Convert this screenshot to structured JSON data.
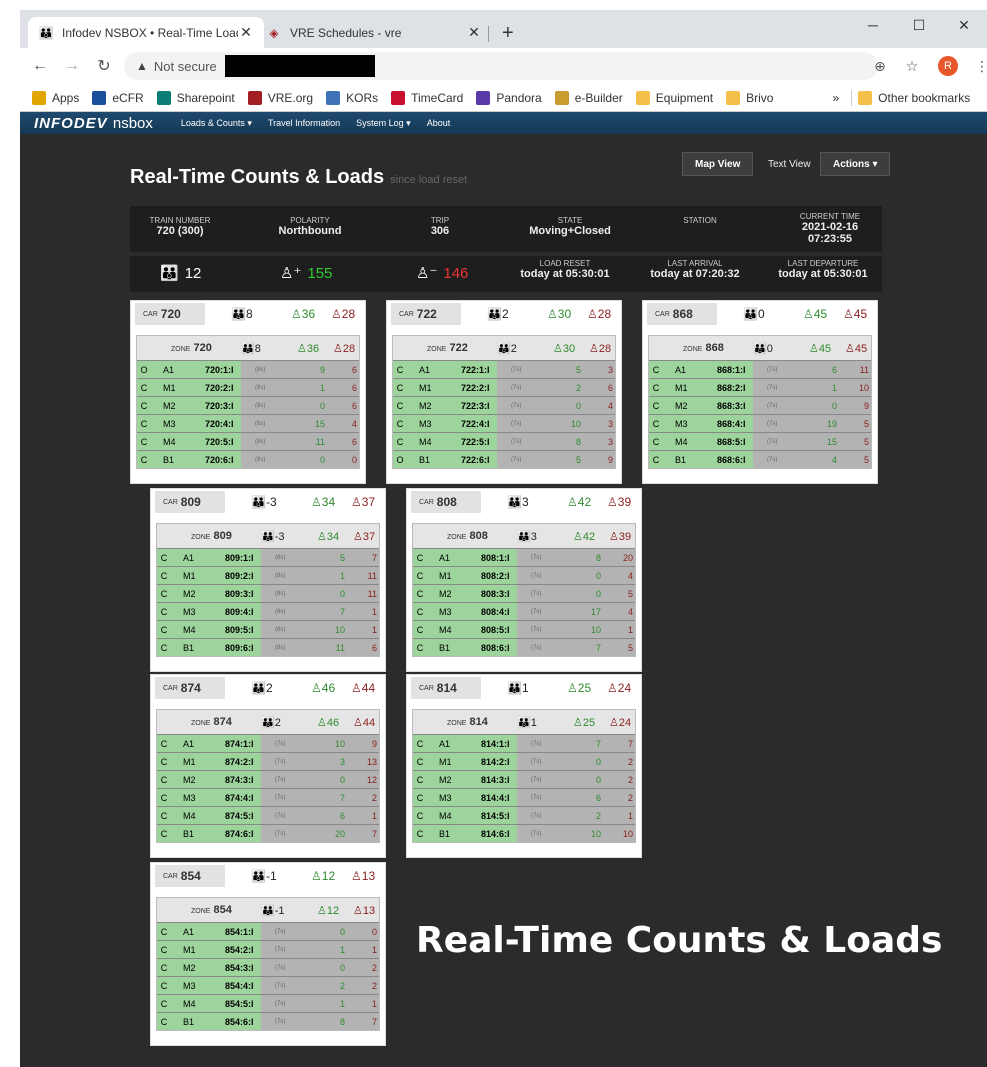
{
  "browser": {
    "tabs": [
      {
        "title": "Infodev NSBOX • Real-Time Load",
        "close": "✕",
        "active": true
      },
      {
        "title": "VRE Schedules - vre",
        "close": "✕",
        "active": false
      }
    ],
    "new_tab": "+",
    "address": {
      "warning": "Not secure"
    },
    "profile_initial": "R",
    "bookmarks": [
      {
        "label": "Apps",
        "color": "#e2a600"
      },
      {
        "label": "eCFR",
        "color": "#1a4f9e"
      },
      {
        "label": "Sharepoint",
        "color": "#0a7c74"
      },
      {
        "label": "VRE.org",
        "color": "#a31e22"
      },
      {
        "label": "KORs",
        "color": "#3f73b8"
      },
      {
        "label": "TimeCard",
        "color": "#c8102e"
      },
      {
        "label": "Pandora",
        "color": "#5a3aa8"
      },
      {
        "label": "e-Builder",
        "color": "#c89c2f"
      },
      {
        "label": "Equipment",
        "color": "#f5c04a"
      },
      {
        "label": "Brivo",
        "color": "#f5c04a"
      }
    ],
    "bookmarks_more": "»",
    "other_bookmarks": "Other bookmarks"
  },
  "app": {
    "brand": "INFODEV",
    "brand_sub": "nsbox",
    "nav": [
      "Loads & Counts ▾",
      "Travel Information",
      "System Log ▾",
      "About"
    ],
    "title": "Real-Time Counts & Loads",
    "title_suffix": "since load reset",
    "buttons": {
      "map": "Map View",
      "text": "Text View",
      "actions": "Actions ▾"
    },
    "info": {
      "train_number_label": "TRAIN NUMBER",
      "train_number": "720 (300)",
      "polarity_label": "POLARITY",
      "polarity": "Northbound",
      "trip_label": "TRIP",
      "trip": "306",
      "state_label": "STATE",
      "state": "Moving+Closed",
      "station_label": "STATION",
      "current_time_label": "CURRENT TIME",
      "current_date": "2021-02-16",
      "current_time": "07:23:55"
    },
    "totals": {
      "occupancy": "12",
      "boarded": "155",
      "alighted": "146",
      "load_reset_label": "LOAD RESET",
      "load_reset": "today at 05:30:01",
      "last_arrival_label": "LAST ARRIVAL",
      "last_arrival": "today at 07:20:32",
      "last_departure_label": "LAST DEPARTURE",
      "last_departure": "today at 05:30:01"
    },
    "car_prefix": "CAR",
    "zone_prefix": "ZONE",
    "cars": [
      {
        "name": "720",
        "occ": "8",
        "on": "36",
        "off": "28",
        "sec": "(8s)",
        "rows": [
          [
            "O",
            "A1",
            "720:1:l",
            "9",
            "6"
          ],
          [
            "C",
            "M1",
            "720:2:l",
            "1",
            "6"
          ],
          [
            "C",
            "M2",
            "720:3:l",
            "0",
            "6"
          ],
          [
            "C",
            "M3",
            "720:4:l",
            "15",
            "4"
          ],
          [
            "C",
            "M4",
            "720:5:l",
            "11",
            "6"
          ],
          [
            "C",
            "B1",
            "720:6:l",
            "0",
            "0"
          ]
        ]
      },
      {
        "name": "722",
        "occ": "2",
        "on": "30",
        "off": "28",
        "sec": "(7s)",
        "rows": [
          [
            "C",
            "A1",
            "722:1:l",
            "5",
            "3"
          ],
          [
            "C",
            "M1",
            "722:2:l",
            "2",
            "6"
          ],
          [
            "C",
            "M2",
            "722:3:l",
            "0",
            "4"
          ],
          [
            "C",
            "M3",
            "722:4:l",
            "10",
            "3"
          ],
          [
            "C",
            "M4",
            "722:5:l",
            "8",
            "3"
          ],
          [
            "O",
            "B1",
            "722:6:l",
            "5",
            "9"
          ]
        ]
      },
      {
        "name": "868",
        "occ": "0",
        "on": "45",
        "off": "45",
        "sec": "(7s)",
        "rows": [
          [
            "C",
            "A1",
            "868:1:l",
            "6",
            "11"
          ],
          [
            "C",
            "M1",
            "868:2:l",
            "1",
            "10"
          ],
          [
            "C",
            "M2",
            "868:3:l",
            "0",
            "9"
          ],
          [
            "C",
            "M3",
            "868:4:l",
            "19",
            "5"
          ],
          [
            "C",
            "M4",
            "868:5:l",
            "15",
            "5"
          ],
          [
            "C",
            "B1",
            "868:6:l",
            "4",
            "5"
          ]
        ]
      },
      {
        "name": "809",
        "occ": "-3",
        "on": "34",
        "off": "37",
        "sec": "(8s)",
        "rows": [
          [
            "C",
            "A1",
            "809:1:l",
            "5",
            "7"
          ],
          [
            "C",
            "M1",
            "809:2:l",
            "1",
            "11"
          ],
          [
            "C",
            "M2",
            "809:3:l",
            "0",
            "11"
          ],
          [
            "C",
            "M3",
            "809:4:l",
            "7",
            "1"
          ],
          [
            "C",
            "M4",
            "809:5:l",
            "10",
            "1"
          ],
          [
            "C",
            "B1",
            "809:6:l",
            "11",
            "6"
          ]
        ]
      },
      {
        "name": "808",
        "occ": "3",
        "on": "42",
        "off": "39",
        "sec": "(7s)",
        "rows": [
          [
            "C",
            "A1",
            "808:1:l",
            "8",
            "20"
          ],
          [
            "C",
            "M1",
            "808:2:l",
            "0",
            "4"
          ],
          [
            "C",
            "M2",
            "808:3:l",
            "0",
            "5"
          ],
          [
            "C",
            "M3",
            "808:4:l",
            "17",
            "4"
          ],
          [
            "C",
            "M4",
            "808:5:l",
            "10",
            "1"
          ],
          [
            "C",
            "B1",
            "808:6:l",
            "7",
            "5"
          ]
        ]
      },
      {
        "name": "874",
        "occ": "2",
        "on": "46",
        "off": "44",
        "sec": "(7s)",
        "rows": [
          [
            "C",
            "A1",
            "874:1:l",
            "10",
            "9"
          ],
          [
            "C",
            "M1",
            "874:2:l",
            "3",
            "13"
          ],
          [
            "C",
            "M2",
            "874:3:l",
            "0",
            "12"
          ],
          [
            "C",
            "M3",
            "874:4:l",
            "7",
            "2"
          ],
          [
            "C",
            "M4",
            "874:5:l",
            "6",
            "1"
          ],
          [
            "C",
            "B1",
            "874:6:l",
            "20",
            "7"
          ]
        ]
      },
      {
        "name": "814",
        "occ": "1",
        "on": "25",
        "off": "24",
        "sec": "(7s)",
        "rows": [
          [
            "C",
            "A1",
            "814:1:l",
            "7",
            "7"
          ],
          [
            "C",
            "M1",
            "814:2:l",
            "0",
            "2"
          ],
          [
            "C",
            "M2",
            "814:3:l",
            "0",
            "2"
          ],
          [
            "C",
            "M3",
            "814:4:l",
            "6",
            "2"
          ],
          [
            "C",
            "M4",
            "814:5:l",
            "2",
            "1"
          ],
          [
            "C",
            "B1",
            "814:6:l",
            "10",
            "10"
          ]
        ]
      },
      {
        "name": "854",
        "occ": "-1",
        "on": "12",
        "off": "13",
        "sec": "(7s)",
        "rows": [
          [
            "C",
            "A1",
            "854:1:l",
            "0",
            "0"
          ],
          [
            "C",
            "M1",
            "854:2:l",
            "1",
            "1"
          ],
          [
            "C",
            "M2",
            "854:3:l",
            "0",
            "2"
          ],
          [
            "C",
            "M3",
            "854:4:l",
            "2",
            "2"
          ],
          [
            "C",
            "M4",
            "854:5:l",
            "1",
            "1"
          ],
          [
            "C",
            "B1",
            "854:6:l",
            "8",
            "7"
          ]
        ]
      }
    ],
    "caption": "Real-Time Counts & Loads"
  }
}
